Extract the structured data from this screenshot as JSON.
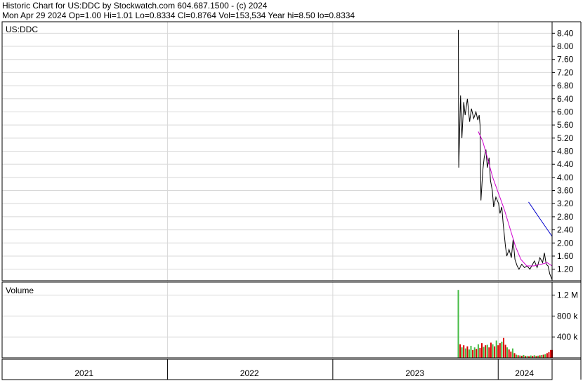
{
  "header": {
    "line1": "Historic Chart for US:DDC by Stockwatch.com 604.687.1500 - (c) 2024",
    "line2": "Mon Apr 29 2024   Op=1.00   Hi=1.01   Lo=0.8334   Cl=0.8764   Vol=153,534   Year hi=8.50   lo=0.8334"
  },
  "chart_data": [
    {
      "type": "line",
      "title": "US:DDC",
      "y_ticks": [
        1.2,
        1.6,
        2.0,
        2.4,
        2.8,
        3.2,
        3.6,
        4.0,
        4.4,
        4.8,
        5.2,
        5.6,
        6.0,
        6.4,
        6.8,
        7.2,
        7.6,
        8.0,
        8.4
      ],
      "y_tick_labels": [
        "1.20",
        "1.60",
        "2.00",
        "2.40",
        "2.80",
        "3.20",
        "3.60",
        "4.00",
        "4.40",
        "4.80",
        "5.20",
        "5.60",
        "6.00",
        "6.40",
        "6.80",
        "7.20",
        "7.60",
        "8.00",
        "8.40"
      ],
      "ylim": [
        0.85,
        8.75
      ],
      "xlim": [
        "2021-01-01",
        "2024-04-29"
      ],
      "x_tick_labels": [
        {
          "label": "2021",
          "date": "2021-07-01"
        },
        {
          "label": "2022",
          "date": "2022-07-01"
        },
        {
          "label": "2023",
          "date": "2023-07-01"
        },
        {
          "label": "2024",
          "date": "2024-02-28"
        }
      ],
      "year_gridlines": [
        "2022-01-01",
        "2023-01-01",
        "2024-01-01"
      ],
      "grid": true,
      "series": [
        {
          "kind": "price",
          "color": "#000000",
          "points": [
            [
              "2023-10-05",
              8.5
            ],
            [
              "2023-10-06",
              4.3
            ],
            [
              "2023-10-10",
              6.5
            ],
            [
              "2023-10-13",
              5.2
            ],
            [
              "2023-10-17",
              6.3
            ],
            [
              "2023-10-20",
              5.9
            ],
            [
              "2023-10-25",
              6.4
            ],
            [
              "2023-10-30",
              5.7
            ],
            [
              "2023-11-03",
              6.1
            ],
            [
              "2023-11-08",
              5.8
            ],
            [
              "2023-11-13",
              6.0
            ],
            [
              "2023-11-17",
              5.75
            ],
            [
              "2023-11-20",
              5.9
            ],
            [
              "2023-11-22",
              5.6
            ],
            [
              "2023-11-24",
              3.3
            ],
            [
              "2023-11-28",
              4.2
            ],
            [
              "2023-12-01",
              4.6
            ],
            [
              "2023-12-05",
              4.85
            ],
            [
              "2023-12-08",
              4.3
            ],
            [
              "2023-12-12",
              4.6
            ],
            [
              "2023-12-15",
              3.9
            ],
            [
              "2023-12-19",
              3.6
            ],
            [
              "2023-12-22",
              3.1
            ],
            [
              "2023-12-27",
              3.4
            ],
            [
              "2024-01-02",
              3.2
            ],
            [
              "2024-01-05",
              2.9
            ],
            [
              "2024-01-09",
              3.1
            ],
            [
              "2024-01-12",
              2.6
            ],
            [
              "2024-01-17",
              1.9
            ],
            [
              "2024-01-20",
              1.6
            ],
            [
              "2024-01-25",
              1.8
            ],
            [
              "2024-01-30",
              1.55
            ],
            [
              "2024-02-03",
              2.1
            ],
            [
              "2024-02-07",
              1.5
            ],
            [
              "2024-02-12",
              1.3
            ],
            [
              "2024-02-16",
              1.2
            ],
            [
              "2024-02-22",
              1.35
            ],
            [
              "2024-02-28",
              1.25
            ],
            [
              "2024-03-05",
              1.3
            ],
            [
              "2024-03-11",
              1.2
            ],
            [
              "2024-03-15",
              1.3
            ],
            [
              "2024-03-21",
              1.45
            ],
            [
              "2024-03-27",
              1.25
            ],
            [
              "2024-04-02",
              1.55
            ],
            [
              "2024-04-08",
              1.4
            ],
            [
              "2024-04-12",
              1.7
            ],
            [
              "2024-04-16",
              1.35
            ],
            [
              "2024-04-20",
              1.3
            ],
            [
              "2024-04-24",
              1.05
            ],
            [
              "2024-04-29",
              0.88
            ]
          ]
        },
        {
          "kind": "moving-average-short",
          "color": "#d000d0",
          "points": [
            [
              "2023-11-18",
              5.4
            ],
            [
              "2023-11-28",
              5.1
            ],
            [
              "2023-12-08",
              4.6
            ],
            [
              "2023-12-20",
              4.0
            ],
            [
              "2024-01-02",
              3.5
            ],
            [
              "2024-01-15",
              3.0
            ],
            [
              "2024-01-28",
              2.4
            ],
            [
              "2024-02-08",
              1.9
            ],
            [
              "2024-02-20",
              1.5
            ],
            [
              "2024-03-04",
              1.3
            ],
            [
              "2024-03-20",
              1.3
            ],
            [
              "2024-04-05",
              1.35
            ],
            [
              "2024-04-18",
              1.4
            ],
            [
              "2024-04-29",
              1.3
            ]
          ]
        },
        {
          "kind": "moving-average-long",
          "color": "#0000cc",
          "points": [
            [
              "2024-03-08",
              3.25
            ],
            [
              "2024-03-30",
              2.8
            ],
            [
              "2024-04-29",
              2.2
            ]
          ]
        }
      ]
    },
    {
      "type": "bar",
      "title": "Volume",
      "y_ticks": [
        400000,
        800000,
        1200000
      ],
      "y_tick_labels": [
        "400 k",
        "800 k",
        "1.2 M"
      ],
      "ylim": [
        0,
        1450000
      ],
      "xlim": [
        "2021-01-01",
        "2024-04-29"
      ],
      "colors": {
        "up": "#44bb44",
        "down": "#dd0000"
      },
      "bars": [
        [
          "2023-10-05",
          1300000,
          "up"
        ],
        [
          "2023-10-09",
          260000,
          "down"
        ],
        [
          "2023-10-13",
          200000,
          "up"
        ],
        [
          "2023-10-17",
          240000,
          "down"
        ],
        [
          "2023-10-21",
          180000,
          "up"
        ],
        [
          "2023-10-25",
          220000,
          "down"
        ],
        [
          "2023-10-29",
          160000,
          "up"
        ],
        [
          "2023-11-02",
          230000,
          "up"
        ],
        [
          "2023-11-06",
          150000,
          "down"
        ],
        [
          "2023-11-10",
          200000,
          "up"
        ],
        [
          "2023-11-14",
          170000,
          "down"
        ],
        [
          "2023-11-18",
          260000,
          "up"
        ],
        [
          "2023-11-22",
          190000,
          "down"
        ],
        [
          "2023-11-26",
          280000,
          "down"
        ],
        [
          "2023-11-30",
          210000,
          "up"
        ],
        [
          "2023-12-04",
          240000,
          "down"
        ],
        [
          "2023-12-08",
          250000,
          "up"
        ],
        [
          "2023-12-12",
          200000,
          "down"
        ],
        [
          "2023-12-16",
          290000,
          "down"
        ],
        [
          "2023-12-20",
          260000,
          "up"
        ],
        [
          "2023-12-24",
          220000,
          "down"
        ],
        [
          "2023-12-28",
          330000,
          "up"
        ],
        [
          "2024-01-01",
          240000,
          "down"
        ],
        [
          "2024-01-05",
          280000,
          "down"
        ],
        [
          "2024-01-09",
          310000,
          "up"
        ],
        [
          "2024-01-13",
          380000,
          "down"
        ],
        [
          "2024-01-17",
          250000,
          "down"
        ],
        [
          "2024-01-21",
          200000,
          "up"
        ],
        [
          "2024-01-25",
          160000,
          "down"
        ],
        [
          "2024-01-29",
          120000,
          "down"
        ],
        [
          "2024-02-02",
          180000,
          "up"
        ],
        [
          "2024-02-06",
          90000,
          "down"
        ],
        [
          "2024-02-10",
          60000,
          "up"
        ],
        [
          "2024-02-14",
          50000,
          "down"
        ],
        [
          "2024-02-18",
          45000,
          "up"
        ],
        [
          "2024-02-22",
          40000,
          "down"
        ],
        [
          "2024-02-26",
          55000,
          "up"
        ],
        [
          "2024-03-01",
          35000,
          "down"
        ],
        [
          "2024-03-05",
          40000,
          "up"
        ],
        [
          "2024-03-09",
          30000,
          "down"
        ],
        [
          "2024-03-13",
          45000,
          "up"
        ],
        [
          "2024-03-17",
          38000,
          "down"
        ],
        [
          "2024-03-21",
          50000,
          "up"
        ],
        [
          "2024-03-25",
          35000,
          "down"
        ],
        [
          "2024-03-29",
          42000,
          "up"
        ],
        [
          "2024-04-02",
          48000,
          "down"
        ],
        [
          "2024-04-06",
          55000,
          "up"
        ],
        [
          "2024-04-10",
          60000,
          "down"
        ],
        [
          "2024-04-14",
          70000,
          "up"
        ],
        [
          "2024-04-18",
          90000,
          "down"
        ],
        [
          "2024-04-22",
          110000,
          "down"
        ],
        [
          "2024-04-26",
          150000,
          "down"
        ],
        [
          "2024-04-29",
          150000,
          "down"
        ]
      ]
    }
  ]
}
